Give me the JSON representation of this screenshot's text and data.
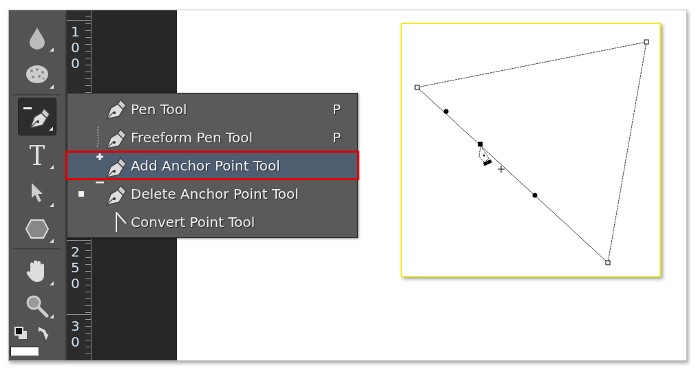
{
  "toolbar": {
    "tools": [
      {
        "kind": "drop",
        "selected": false
      },
      {
        "kind": "sponge",
        "selected": false
      },
      {
        "kind": "separator"
      },
      {
        "kind": "pen",
        "selected": true
      },
      {
        "kind": "type",
        "selected": false
      },
      {
        "kind": "arrow",
        "selected": false
      },
      {
        "kind": "hexagon",
        "selected": false
      },
      {
        "kind": "separator"
      },
      {
        "kind": "hand",
        "selected": false
      },
      {
        "kind": "zoom",
        "selected": false
      },
      {
        "kind": "colors"
      },
      {
        "kind": "swatch"
      }
    ]
  },
  "ruler": {
    "labels": [
      {
        "label": "100"
      },
      {
        "label": "250"
      },
      {
        "label": "30"
      }
    ]
  },
  "flyout_menu": {
    "items": [
      {
        "kind": "pen",
        "label": "Pen Tool",
        "shortcut": "P",
        "selected": false,
        "current": false
      },
      {
        "kind": "freeform",
        "label": "Freeform Pen Tool",
        "shortcut": "P",
        "selected": false,
        "current": false
      },
      {
        "kind": "add",
        "label": "Add Anchor Point Tool",
        "selected": true,
        "current": false
      },
      {
        "kind": "delete",
        "label": "Delete Anchor Point Tool",
        "selected": false,
        "current": true
      },
      {
        "kind": "convert",
        "label": "Convert Point Tool",
        "selected": false,
        "current": false
      }
    ]
  },
  "canvas": {
    "kind": "triangle-path"
  }
}
